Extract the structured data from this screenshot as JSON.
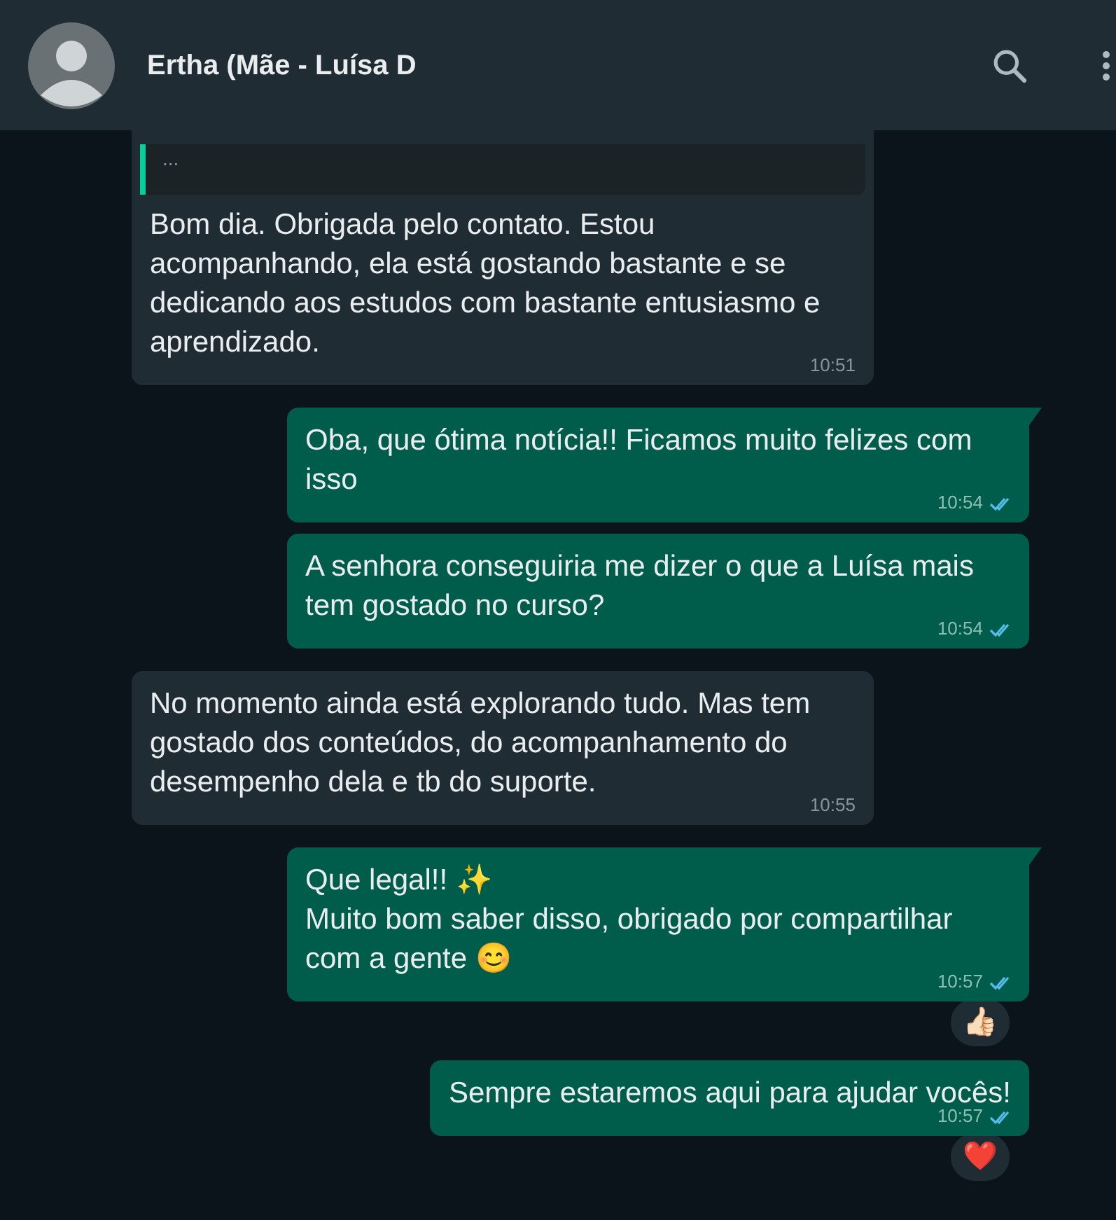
{
  "header": {
    "contact_name": "Ertha (Mãe - Luísa D"
  },
  "messages": [
    {
      "kind": "incoming",
      "quote": "...",
      "text": "Bom dia. Obrigada pelo contato. Estou acompanhando, ela está gostando bastante e se dedicando aos estudos com bastante entusiasmo e aprendizado.",
      "time": "10:51"
    },
    {
      "kind": "outgoing",
      "tail": true,
      "text": "Oba, que ótima notícia!! Ficamos muito felizes com isso",
      "time": "10:54",
      "read": true
    },
    {
      "kind": "outgoing",
      "tail": false,
      "text": "A senhora conseguiria me dizer o que a Luísa mais tem gostado no curso?",
      "time": "10:54",
      "read": true
    },
    {
      "kind": "incoming",
      "text": "No momento ainda está explorando tudo. Mas tem gostado dos conteúdos, do acompanhamento do desempenho dela e tb do suporte.",
      "time": "10:55"
    },
    {
      "kind": "outgoing",
      "tail": true,
      "text": "Que legal!! ✨\nMuito bom saber disso, obrigado por compartilhar com a gente 😊",
      "time": "10:57",
      "read": true,
      "reaction": "👍🏻"
    },
    {
      "kind": "outgoing",
      "tail": false,
      "text": "Sempre estaremos aqui para ajudar vocês!",
      "time": "10:57",
      "read": true,
      "reaction": "❤️"
    }
  ]
}
